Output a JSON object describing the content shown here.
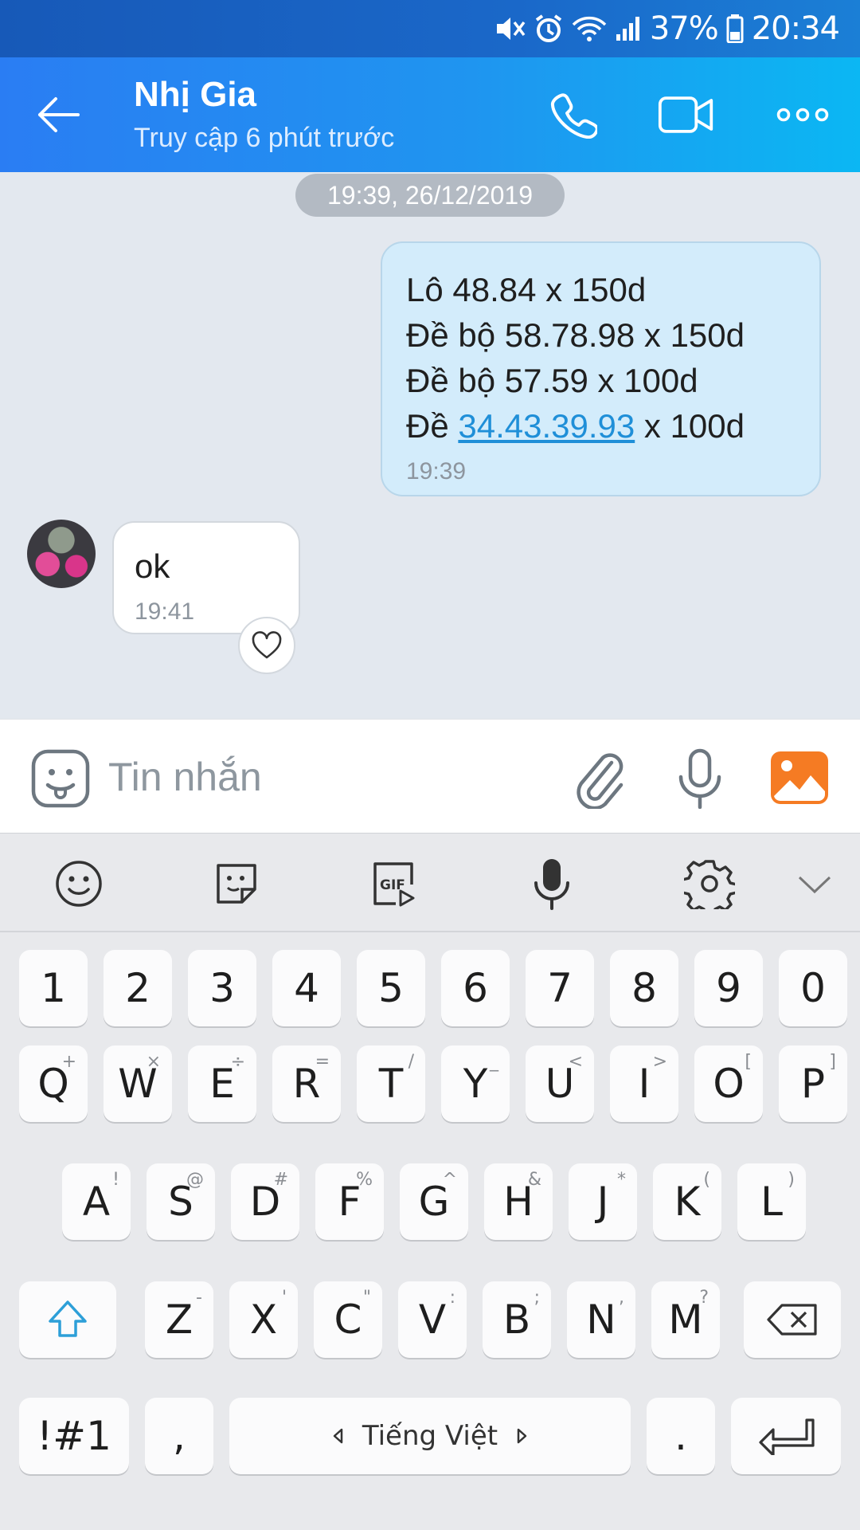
{
  "status_bar": {
    "battery": "37%",
    "time": "20:34"
  },
  "header": {
    "contact_name": "Nhị Gia",
    "contact_status": "Truy cập 6 phút trước"
  },
  "chat": {
    "date_separator": "19:39, 26/12/2019",
    "outgoing": {
      "lines": [
        "Lô 48.84 x 150d",
        "Đề bộ 58.78.98 x 150d",
        "Đề bộ 57.59 x 100d"
      ],
      "last_line_prefix": "Đề ",
      "last_line_link": "34.43.39.93",
      "last_line_suffix": " x 100d",
      "time": "19:39"
    },
    "incoming": {
      "text": "ok",
      "time": "19:41"
    }
  },
  "composer": {
    "placeholder": "Tin nhắn"
  },
  "keyboard": {
    "number_row": [
      "1",
      "2",
      "3",
      "4",
      "5",
      "6",
      "7",
      "8",
      "9",
      "0"
    ],
    "row1": [
      {
        "k": "Q",
        "s": "+"
      },
      {
        "k": "W",
        "s": "×"
      },
      {
        "k": "E",
        "s": "÷"
      },
      {
        "k": "R",
        "s": "="
      },
      {
        "k": "T",
        "s": "/"
      },
      {
        "k": "Y",
        "s": "_"
      },
      {
        "k": "U",
        "s": "<"
      },
      {
        "k": "I",
        "s": ">"
      },
      {
        "k": "O",
        "s": "["
      },
      {
        "k": "P",
        "s": "]"
      }
    ],
    "row2": [
      {
        "k": "A",
        "s": "!"
      },
      {
        "k": "S",
        "s": "@"
      },
      {
        "k": "D",
        "s": "#"
      },
      {
        "k": "F",
        "s": "%"
      },
      {
        "k": "G",
        "s": "^"
      },
      {
        "k": "H",
        "s": "&"
      },
      {
        "k": "J",
        "s": "*"
      },
      {
        "k": "K",
        "s": "("
      },
      {
        "k": "L",
        "s": ")"
      }
    ],
    "row3": [
      {
        "k": "Z",
        "s": "-"
      },
      {
        "k": "X",
        "s": "'"
      },
      {
        "k": "C",
        "s": "\""
      },
      {
        "k": "V",
        "s": ":"
      },
      {
        "k": "B",
        "s": ";"
      },
      {
        "k": "N",
        "s": ","
      },
      {
        "k": "M",
        "s": "?"
      }
    ],
    "symbols_label": "!#1",
    "comma": ",",
    "space_label": "Tiếng Việt",
    "period": "."
  }
}
